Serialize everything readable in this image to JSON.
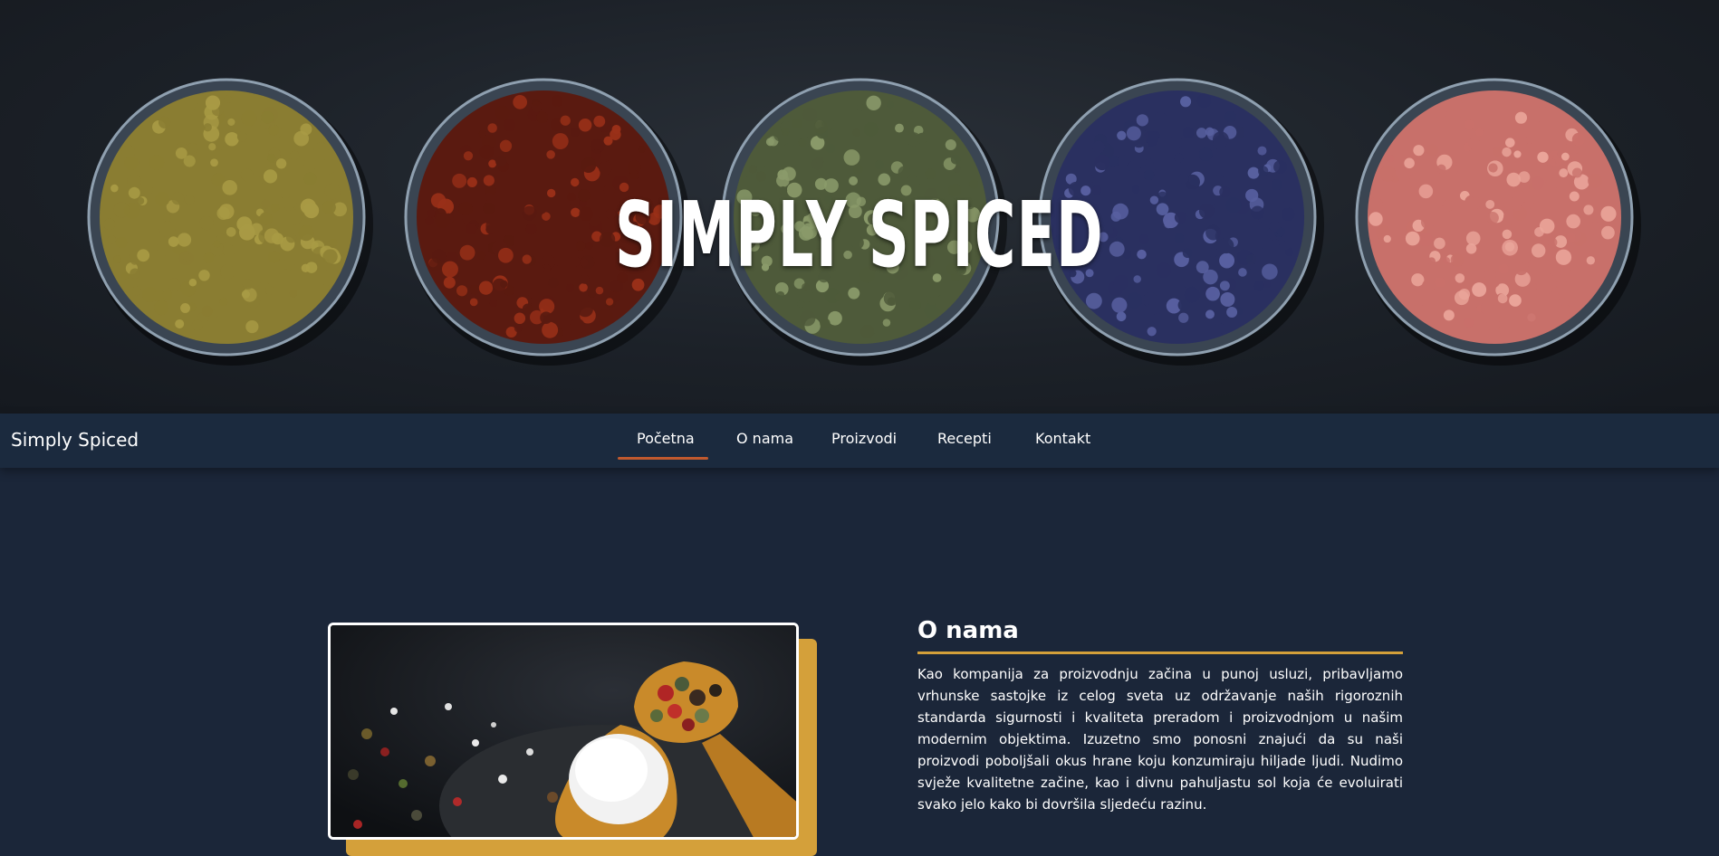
{
  "hero": {
    "title": "SIMPLY SPICED",
    "bowls": [
      {
        "name": "mustard-seed-bowl",
        "fill": "#8a7d32",
        "dot": "#a89a44"
      },
      {
        "name": "chili-flakes-bowl",
        "fill": "#5a1a10",
        "dot": "#9a3018"
      },
      {
        "name": "fennel-seed-bowl",
        "fill": "#4e5a3a",
        "dot": "#8a9a6a"
      },
      {
        "name": "lavender-bowl",
        "fill": "#2a3060",
        "dot": "#5860a0"
      },
      {
        "name": "pink-salt-bowl",
        "fill": "#c8706a",
        "dot": "#eaa59a"
      }
    ]
  },
  "navbar": {
    "brand": "Simply Spiced",
    "items": [
      {
        "label": "Početna",
        "active": true
      },
      {
        "label": "O nama",
        "active": false
      },
      {
        "label": "Proizvodi",
        "active": false
      },
      {
        "label": "Recepti",
        "active": false
      },
      {
        "label": "Kontakt",
        "active": false
      }
    ],
    "active_color": "#c0592e"
  },
  "about": {
    "heading": "O nama",
    "paragraph": "Kao kompanija za proizvodnju začina u punoj usluzi, pribavljamo vrhunske sastojke iz celog sveta uz održavanje naših rigoroznih standarda sigurnosti i kvaliteta preradom i proizvodnjom u našim modernim objektima. Izuzetno smo ponosni znajući da su naši proizvodi poboljšali okus hrane koju konzumiraju hiljade ljudi. Nudimo svježe kvalitetne začine, kao i divnu pahuljastu sol koja će evoluirati svako jelo kako bi dovršila sljedeću razinu.",
    "accent_color": "#d4a03a"
  },
  "colors": {
    "page_bg": "#1b2639",
    "navbar_bg": "#1b2a3e"
  }
}
